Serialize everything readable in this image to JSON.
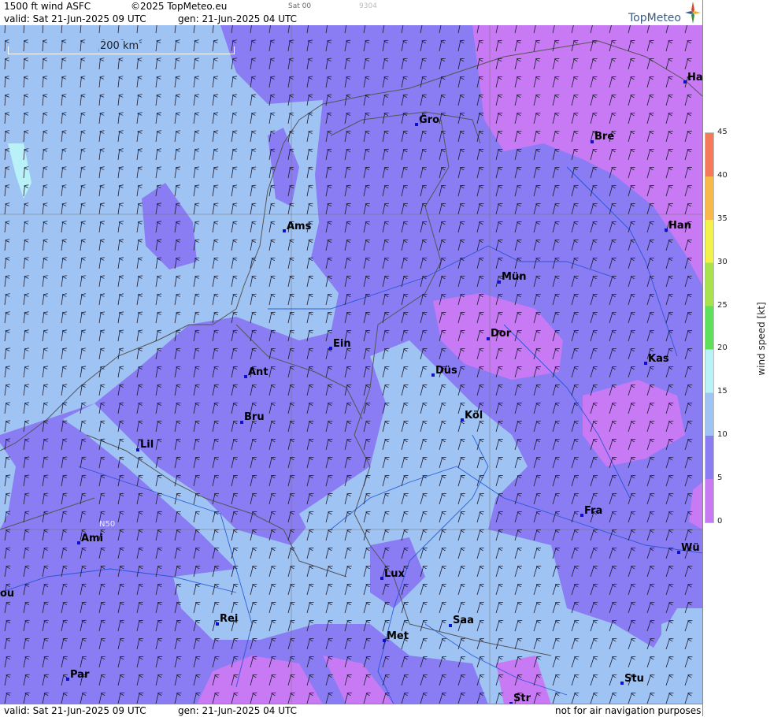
{
  "header": {
    "product": "1500 ft wind ASFC",
    "copyright": "©2025 TopMeteo.eu",
    "run": "Sat 00",
    "code": "9304",
    "valid": "valid:  Sat  21-Jun-2025  09 UTC",
    "gen": "gen: 21-Jun-2025 04 UTC"
  },
  "footer": {
    "valid": "valid:  Sat  21-Jun-2025  09 UTC",
    "gen": "gen: 21-Jun-2025 04 UTC",
    "note": "not for air navigation purposes"
  },
  "logo": {
    "text": "TopMeteo"
  },
  "scale": {
    "label": "200 km"
  },
  "grid_label": "N50",
  "legend": {
    "title": "wind speed  [kt]",
    "ticks": [
      "45",
      "40",
      "35",
      "30",
      "25",
      "20",
      "15",
      "10",
      "5",
      "0"
    ],
    "colors": {
      "kt0_5": "#c87af5",
      "kt5_10": "#8a7cf3",
      "kt10_15": "#9fc4f4",
      "kt15_20": "#b8f2f8",
      "kt20_25": "#5fe05a",
      "kt25_30": "#a8e24c",
      "kt30_35": "#f2f24a",
      "kt35_40": "#f8b84a",
      "kt40_45": "#f47a5a"
    }
  },
  "cities": [
    {
      "name": "Ha"
    },
    {
      "name": "Gro"
    },
    {
      "name": "Bre"
    },
    {
      "name": "Ams"
    },
    {
      "name": "Han"
    },
    {
      "name": "Mün"
    },
    {
      "name": "Dor"
    },
    {
      "name": "Ein"
    },
    {
      "name": "Kas"
    },
    {
      "name": "Düs"
    },
    {
      "name": "Ant"
    },
    {
      "name": "Köl"
    },
    {
      "name": "Bru"
    },
    {
      "name": "Lil"
    },
    {
      "name": "Fra"
    },
    {
      "name": "Ami"
    },
    {
      "name": "Wü"
    },
    {
      "name": "ou"
    },
    {
      "name": "Lux"
    },
    {
      "name": "Rei"
    },
    {
      "name": "Saa"
    },
    {
      "name": "Met"
    },
    {
      "name": "Par"
    },
    {
      "name": "Stu"
    },
    {
      "name": "Str"
    }
  ]
}
